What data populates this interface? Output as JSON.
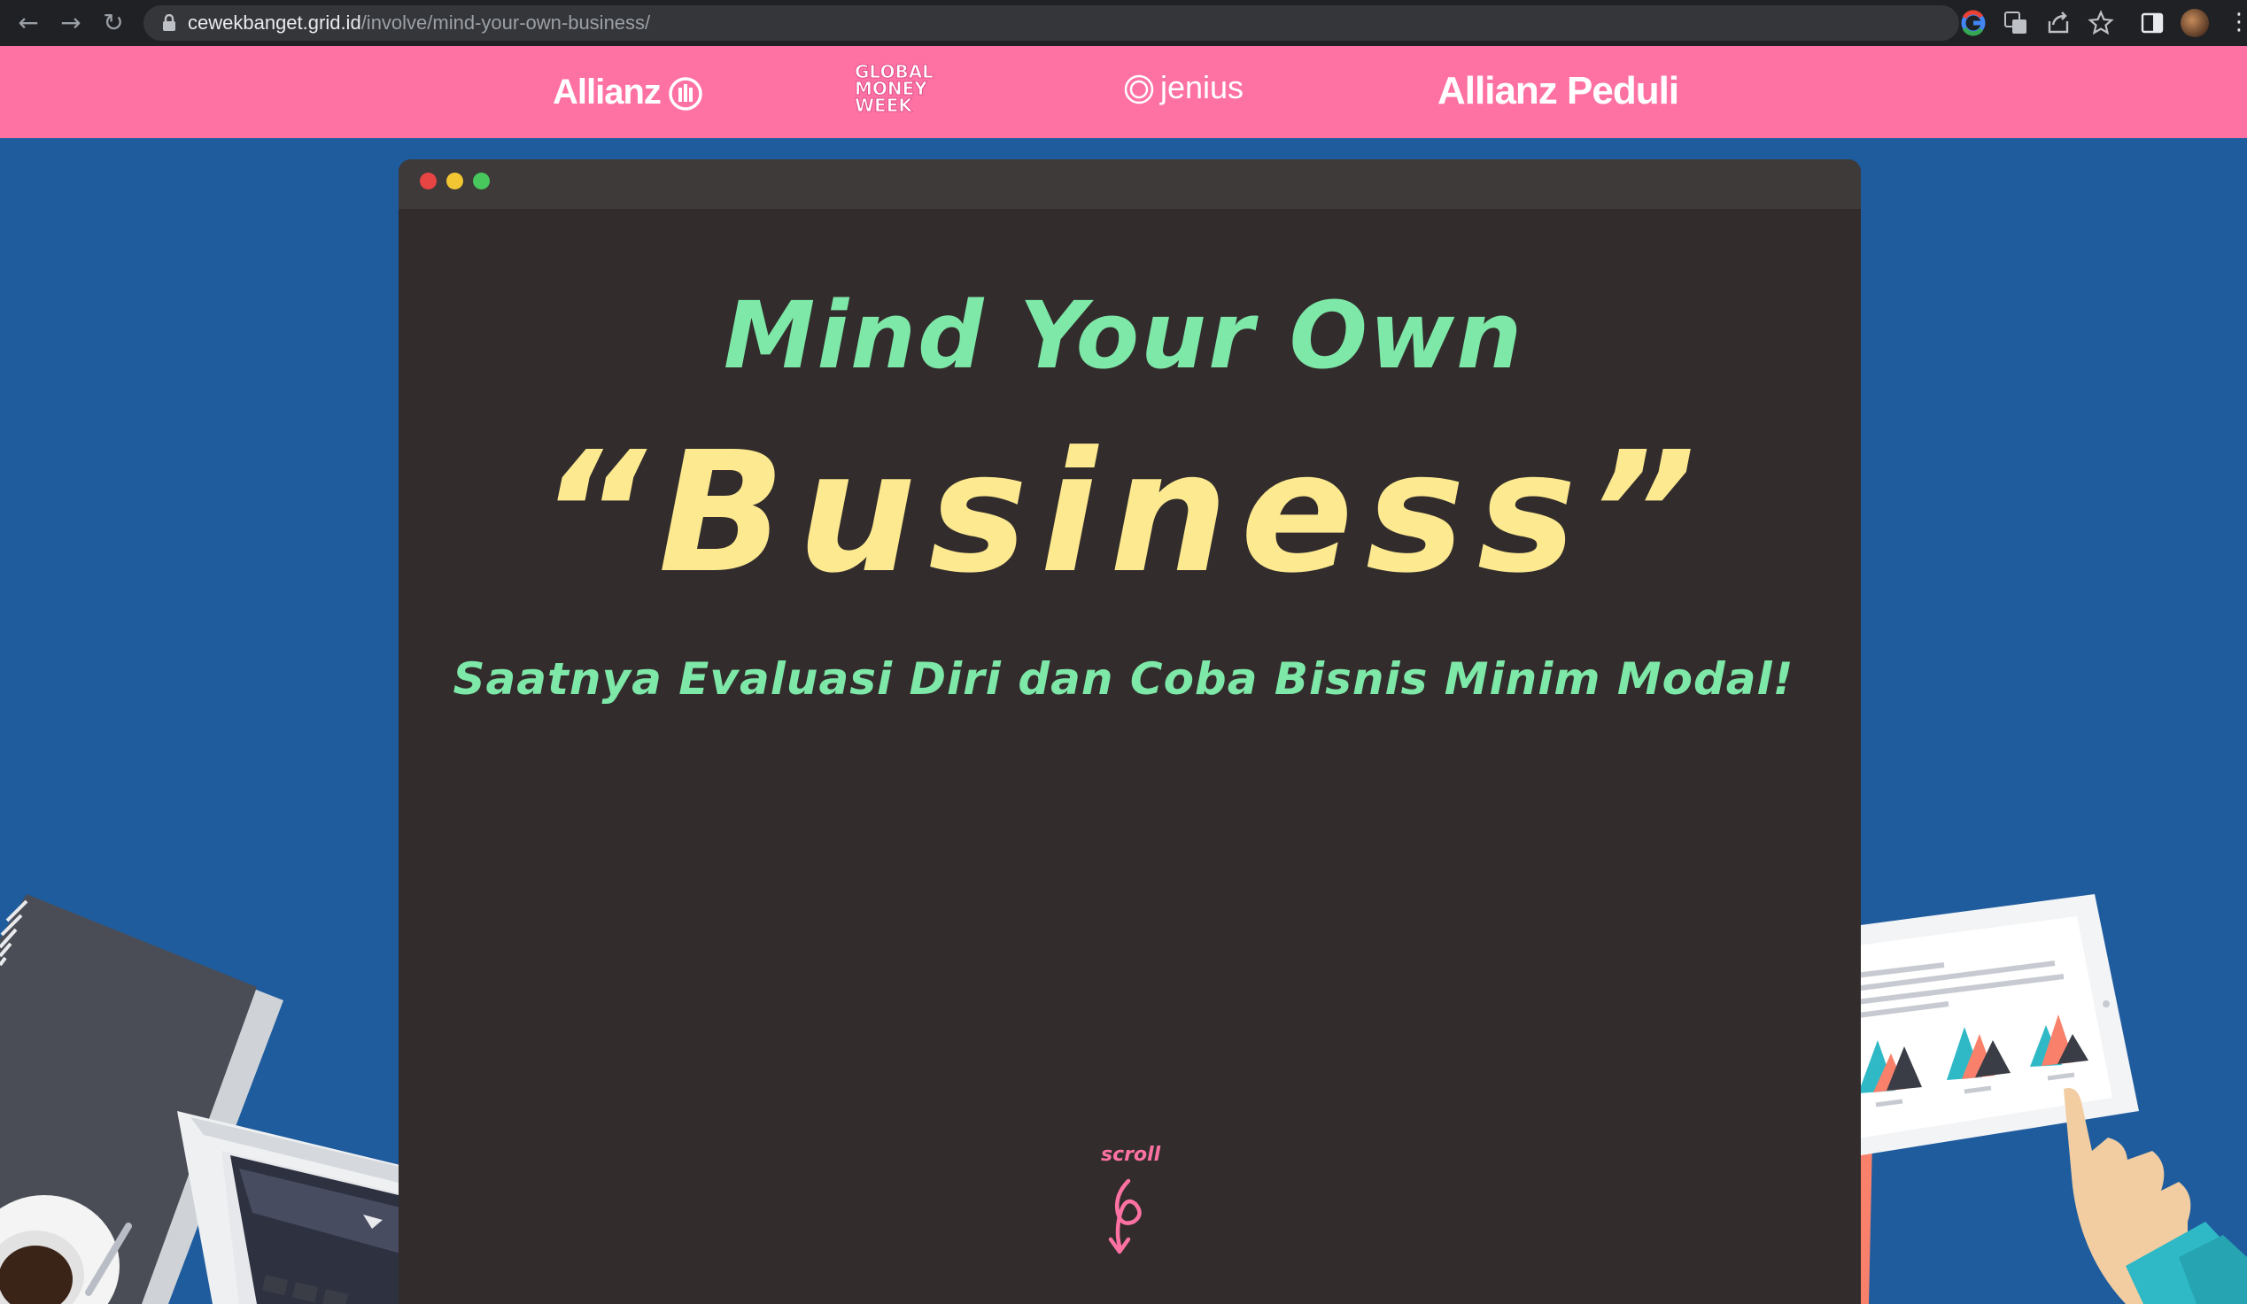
{
  "browser": {
    "url_host": "cewekbanget.grid.id",
    "url_path": "/involve/mind-your-own-business/",
    "icons": [
      "back-icon",
      "forward-icon",
      "reload-icon",
      "lock-icon",
      "google-icon",
      "translate-icon",
      "share-icon",
      "bookmark-star-icon",
      "side-panel-icon",
      "profile-avatar",
      "menu-icon"
    ]
  },
  "sponsors": {
    "allianz": "Allianz",
    "global_money_week": [
      "GLOBAL",
      "MONEY",
      "WEEK"
    ],
    "jenius": "jenius",
    "allianz_peduli": "Allianz Peduli"
  },
  "hero": {
    "title_line1": "Mind Your Own",
    "title_line2": "“Business”",
    "subtitle": "Saatnya Evaluasi Diri dan Coba Bisnis Minim Modal!",
    "scroll_label": "scroll"
  },
  "colors": {
    "background": "#1f5c9e",
    "sponsor_bar": "#fe72a3",
    "window": "#322d2c",
    "title_green": "#7ee8a8",
    "title_yellow": "#fde990"
  }
}
